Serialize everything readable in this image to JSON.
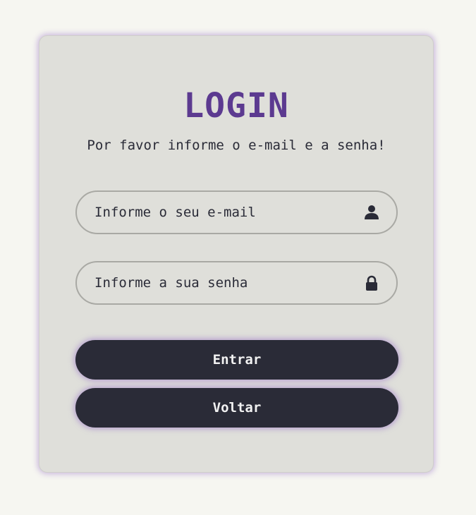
{
  "login": {
    "title": "LOGIN",
    "subtitle": "Por favor informe o e-mail e a senha!",
    "email": {
      "placeholder": "Informe o seu e-mail",
      "value": "",
      "icon": "user-icon"
    },
    "password": {
      "placeholder": "Informe a sua senha",
      "value": "",
      "icon": "lock-icon"
    },
    "buttons": {
      "enter_label": "Entrar",
      "back_label": "Voltar"
    }
  },
  "colors": {
    "page_background": "#f6f6f1",
    "card_background": "#dfdfda",
    "title": "#5c3a90",
    "button": "#2a2b37",
    "button_text": "#f2f2f2",
    "glow": "#966ec8"
  }
}
